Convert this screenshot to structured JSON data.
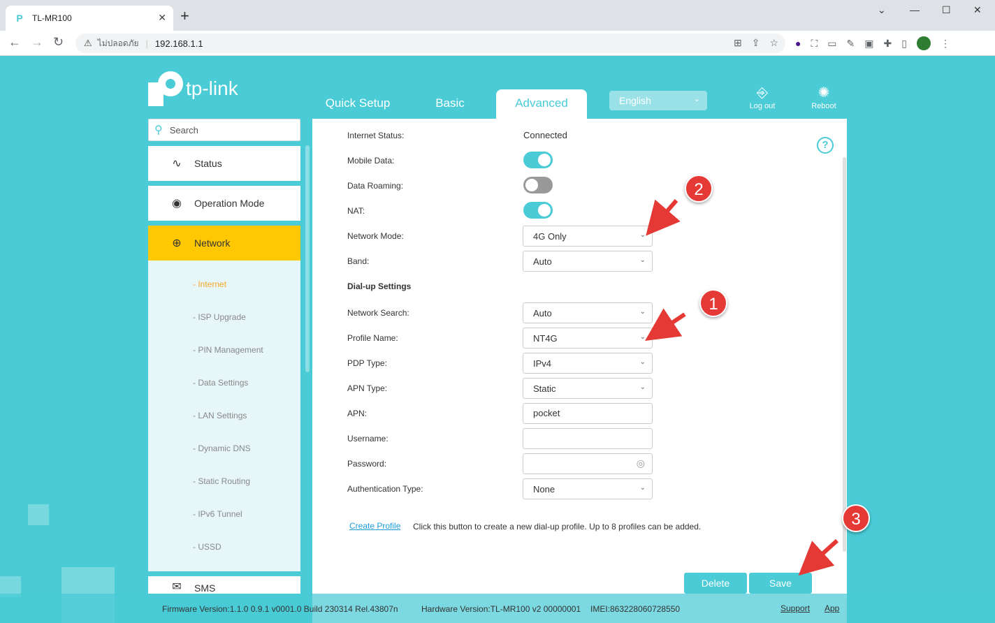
{
  "browser": {
    "tab_title": "TL-MR100",
    "new_tab": "+",
    "insecure_label": "ไม่ปลอดภัย",
    "url": "192.168.1.1"
  },
  "header": {
    "logo_text": "tp-link",
    "tabs": [
      {
        "label": "Quick Setup"
      },
      {
        "label": "Basic"
      },
      {
        "label": "Advanced"
      }
    ],
    "language": "English",
    "logout_label": "Log out",
    "reboot_label": "Reboot"
  },
  "sidebar": {
    "search_placeholder": "Search",
    "menu": [
      {
        "label": "Status"
      },
      {
        "label": "Operation Mode"
      },
      {
        "label": "Network"
      },
      {
        "label": "SMS"
      }
    ],
    "submenu": [
      {
        "label": "- Internet"
      },
      {
        "label": "- ISP Upgrade"
      },
      {
        "label": "- PIN Management"
      },
      {
        "label": "- Data Settings"
      },
      {
        "label": "- LAN Settings"
      },
      {
        "label": "- Dynamic DNS"
      },
      {
        "label": "- Static Routing"
      },
      {
        "label": "- IPv6 Tunnel"
      },
      {
        "label": "- USSD"
      }
    ]
  },
  "form": {
    "internet_status_label": "Internet Status:",
    "internet_status_value": "Connected",
    "mobile_data_label": "Mobile Data:",
    "mobile_data_on": true,
    "data_roaming_label": "Data Roaming:",
    "data_roaming_on": false,
    "nat_label": "NAT:",
    "nat_on": true,
    "network_mode_label": "Network Mode:",
    "network_mode_value": "4G Only",
    "band_label": "Band:",
    "band_value": "Auto",
    "dialup_heading": "Dial-up Settings",
    "network_search_label": "Network Search:",
    "network_search_value": "Auto",
    "profile_name_label": "Profile Name:",
    "profile_name_value": "NT4G",
    "pdp_type_label": "PDP Type:",
    "pdp_type_value": "IPv4",
    "apn_type_label": "APN Type:",
    "apn_type_value": "Static",
    "apn_label": "APN:",
    "apn_value": "pocket",
    "username_label": "Username:",
    "username_value": "",
    "password_label": "Password:",
    "password_value": "",
    "auth_type_label": "Authentication Type:",
    "auth_type_value": "None",
    "create_profile_label": "Create Profile",
    "create_profile_hint": "Click this button to create a new dial-up profile. Up to 8 profiles can be added.",
    "delete_label": "Delete",
    "save_label": "Save"
  },
  "footer": {
    "firmware": "Firmware Version:1.1.0 0.9.1 v0001.0 Build 230314 Rel.43807n",
    "hardware": "Hardware Version:TL-MR100 v2 00000001",
    "imei": "IMEI:863228060728550",
    "support": "Support",
    "app": "App"
  },
  "annotations": {
    "badge_1": "1",
    "badge_2": "2",
    "badge_3": "3",
    "color": "#e53935"
  },
  "colors": {
    "brand": "#4acbd6",
    "active_menu": "#ffc800",
    "active_submenu": "#f5a623"
  }
}
